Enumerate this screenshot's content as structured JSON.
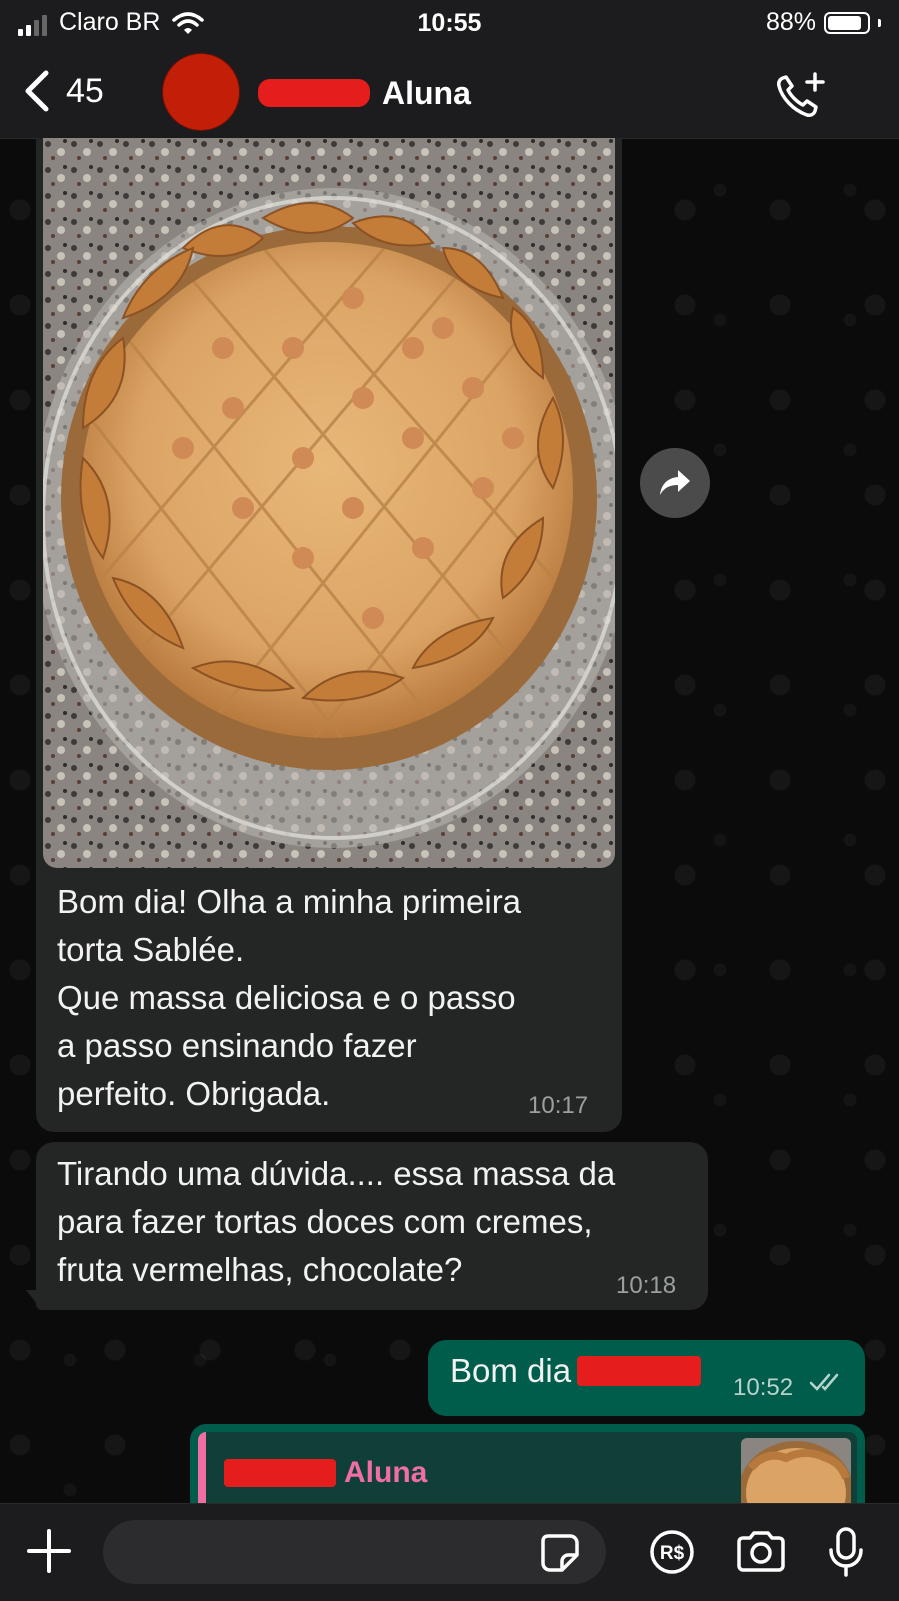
{
  "status_bar": {
    "carrier": "Claro BR",
    "time": "10:55",
    "battery": "88%",
    "battery_level": 0.88
  },
  "header": {
    "back_count": "45",
    "contact_name_visible": "Aluna",
    "avatar_color": "#c21e08"
  },
  "messages": [
    {
      "direction": "incoming",
      "has_photo": true,
      "text": "Bom dia! Olha a minha primeira\ntorta Sablée.\nQue massa deliciosa  e o passo\na passo ensinando fazer\nperfeito. Obrigada.",
      "time": "10:17"
    },
    {
      "direction": "incoming",
      "text": "Tirando uma dúvida.... essa massa da\npara fazer tortas doces com cremes,\nfruta vermelhas, chocolate?",
      "time": "10:18"
    },
    {
      "direction": "outgoing",
      "text": "Bom dia",
      "time": "10:52",
      "status": "read"
    },
    {
      "direction": "outgoing",
      "reply_to_name": "Aluna"
    }
  ],
  "icons": {
    "back": "chevron-left-icon",
    "call": "add-call-icon",
    "forward": "forward-icon",
    "plus": "plus-icon",
    "sticker": "sticker-icon",
    "payment": "payment-real-icon",
    "camera": "camera-icon",
    "mic": "microphone-icon"
  },
  "input": {
    "placeholder": ""
  },
  "colors": {
    "outgoing_bubble": "#005c4b",
    "incoming_bubble": "#242626",
    "reply_accent": "#f06ea4",
    "redaction": "#e51d1d"
  }
}
